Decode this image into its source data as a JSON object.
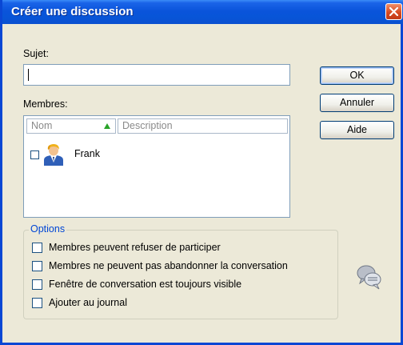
{
  "window": {
    "title": "Créer une discussion"
  },
  "subject": {
    "label": "Sujet:",
    "value": ""
  },
  "members": {
    "label": "Membres:",
    "columns": {
      "name": "Nom",
      "description": "Description"
    },
    "items": [
      {
        "name": "Frank",
        "checked": false
      }
    ]
  },
  "buttons": {
    "ok": "OK",
    "cancel": "Annuler",
    "help": "Aide"
  },
  "options": {
    "legend": "Options",
    "items": [
      {
        "label": "Membres peuvent refuser de participer",
        "checked": false
      },
      {
        "label": "Membres ne peuvent pas abandonner la conversation",
        "checked": false
      },
      {
        "label": "Fenêtre de conversation est toujours visible",
        "checked": false
      },
      {
        "label": "Ajouter au journal",
        "checked": false
      }
    ]
  },
  "icons": {
    "close": "close-icon",
    "avatar": "user-avatar-icon",
    "chat": "chat-bubbles-icon",
    "sort": "sort-ascending-icon"
  },
  "colors": {
    "titlebar": "#0a54db",
    "legend": "#0046d5",
    "sort_arrow": "#2aa32a"
  }
}
